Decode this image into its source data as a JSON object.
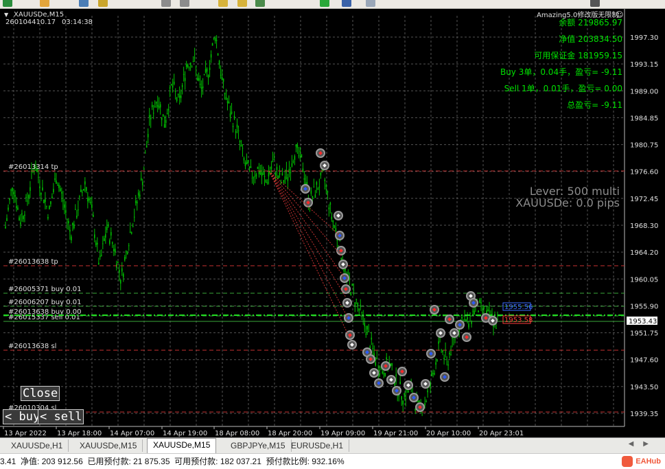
{
  "window": {
    "symbol_header": "XAUUSDe,M15",
    "ticket_time": "260104410.17",
    "clock": "03:14:38"
  },
  "ea": {
    "name": "Amazing5.0修改版无限制",
    "smile": "☺",
    "balance": "余额 219865.97",
    "equity": "净值 203834.50",
    "free_margin": "可用保证金 181959.15",
    "buy_line": "Buy 3单，0.04手，盈亏= -9.11",
    "sell_line": "Sell 1单，0.01手，盈亏= 0.00",
    "total_line": "总盈亏= -9.11",
    "lever": "Lever: 500 multi",
    "pips": "XAUUSDe: 0.0 pips"
  },
  "buttons": {
    "close": "Close",
    "buy": "buy",
    "sell": "sell",
    "buy_prefix": "<",
    "sell_prefix": "<"
  },
  "order_labels": [
    {
      "text": "#26013314 tp",
      "color": "#ff3b3b"
    },
    {
      "text": "#26013638 tp",
      "color": "#ff3b3b"
    },
    {
      "text": "#26005371 buy 0.01",
      "color": "#33cc33"
    },
    {
      "text": "#26006207 buy 0.01",
      "color": "#33cc33"
    },
    {
      "text": "#26013638 buy 0.00",
      "color": "#33cc33"
    },
    {
      "text": "#26015337 sell 0.01",
      "color": "#33cc33"
    },
    {
      "text": "#26013638 sl",
      "color": "#ff3b3b"
    },
    {
      "text": "#26010304 sl",
      "color": "#ff3b3b"
    }
  ],
  "price_box": {
    "current": "1953.43"
  },
  "price_tags": [
    {
      "text": "1955.56",
      "color": "#3a6bff"
    },
    {
      "text": "1953.58",
      "color": "#ff3b3b"
    }
  ],
  "chart_data": {
    "type": "candlestick",
    "y_ticks": [
      "1997.30",
      "1993.15",
      "1989.00",
      "1984.85",
      "1980.75",
      "1976.60",
      "1972.45",
      "1968.30",
      "1964.20",
      "1960.05",
      "1955.90",
      "1951.75",
      "1947.60",
      "1943.50",
      "1939.35"
    ],
    "ylim": [
      1939.35,
      1997.3
    ],
    "x_ticks": [
      "13 Apr 2022",
      "13 Apr 18:00",
      "14 Apr 07:00",
      "14 Apr 19:00",
      "18 Apr 08:00",
      "18 Apr 20:00",
      "19 Apr 09:00",
      "19 Apr 21:00",
      "20 Apr 10:00",
      "20 Apr 23:01"
    ],
    "close_path": [
      1968,
      1975,
      1969,
      1972,
      1978,
      1974,
      1970,
      1976,
      1972,
      1967,
      1971,
      1975,
      1970,
      1962,
      1968,
      1965,
      1960,
      1966,
      1971,
      1976,
      1985,
      1988,
      1984,
      1990,
      1987,
      1993,
      1994,
      1989,
      1992,
      1998,
      1990,
      1986,
      1983,
      1978,
      1976,
      1977,
      1975,
      1978,
      1975,
      1976,
      1980,
      1978,
      1972,
      1974,
      1976,
      1970,
      1966,
      1961,
      1958,
      1955,
      1952,
      1948,
      1946,
      1947,
      1944,
      1942,
      1943,
      1940,
      1941,
      1945,
      1950,
      1947,
      1951,
      1954,
      1953,
      1956,
      1955,
      1954,
      1953
    ]
  },
  "tabs": [
    {
      "label": "XAUUSDe,H1",
      "active": false
    },
    {
      "label": "XAUUSDe,M15",
      "active": false
    },
    {
      "label": "XAUUSDe,M15",
      "active": true
    },
    {
      "label": "GBPJPYe,M15",
      "active": false
    },
    {
      "label": "EURUSDe,H1",
      "active": false
    }
  ],
  "status": {
    "balance_fragment": "3.41",
    "equity": "净值: 203 912.56",
    "used_margin": "已用预付款: 21 875.35",
    "free_margin": "可用预付款: 182 037.21",
    "margin_level": "预付款比例: 932.16%",
    "brand": "EAHub"
  },
  "colors": {
    "bull": "#00c000",
    "grid": "#5a5a5a",
    "text": "#e0e0e0",
    "ea_text": "#00e000"
  }
}
